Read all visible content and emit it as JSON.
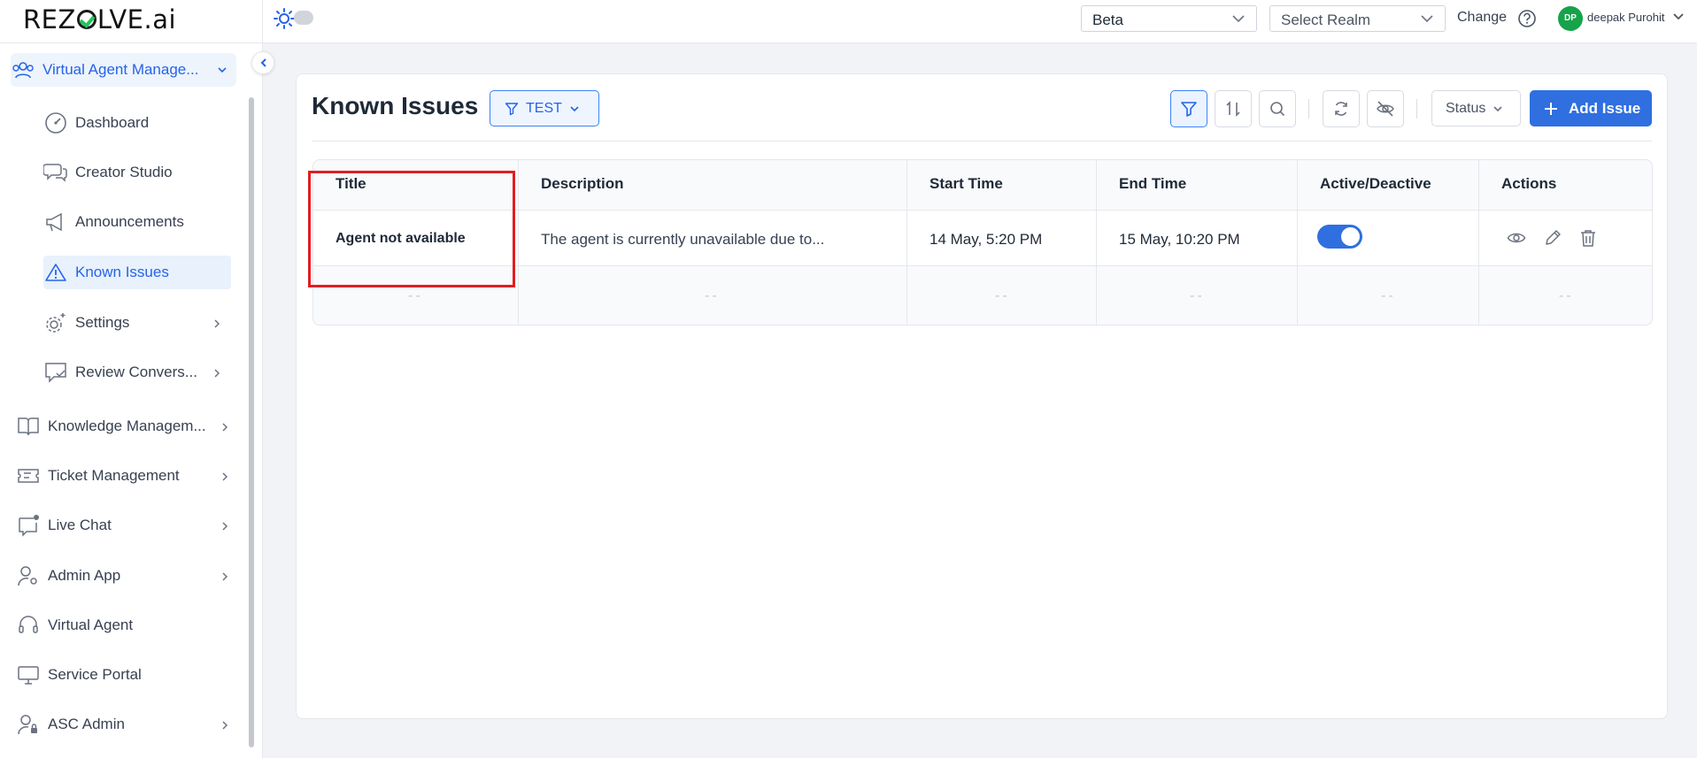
{
  "brand": {
    "logo_pre": "REZ",
    "logo_post": "LVE.ai"
  },
  "header": {
    "environment_select": "Beta",
    "realm_placeholder": "Select Realm",
    "change_label": "Change",
    "user_initials": "DP",
    "user_name": "deepak Purohit"
  },
  "sidebar": {
    "group": {
      "label": "Virtual Agent Manage..."
    },
    "sub_items": [
      {
        "label": "Dashboard",
        "icon": "gauge-icon"
      },
      {
        "label": "Creator Studio",
        "icon": "chat-bubbles-icon"
      },
      {
        "label": "Announcements",
        "icon": "megaphone-icon"
      },
      {
        "label": "Known Issues",
        "icon": "warning-icon",
        "active": true
      },
      {
        "label": "Settings",
        "icon": "gear-icon"
      },
      {
        "label": "Review Convers...",
        "icon": "chat-check-icon"
      }
    ],
    "items": [
      {
        "label": "Knowledge Managem...",
        "icon": "book-icon"
      },
      {
        "label": "Ticket Management",
        "icon": "ticket-icon"
      },
      {
        "label": "Live Chat",
        "icon": "live-chat-icon"
      },
      {
        "label": "Admin App",
        "icon": "user-gear-icon"
      },
      {
        "label": "Virtual Agent",
        "icon": "headset-icon"
      },
      {
        "label": "Service Portal",
        "icon": "monitor-icon"
      },
      {
        "label": "ASC Admin",
        "icon": "user-lock-icon"
      }
    ]
  },
  "page": {
    "title": "Known Issues",
    "filter_chip": "TEST",
    "status_button": "Status",
    "add_button": "Add Issue"
  },
  "table": {
    "columns": [
      "Title",
      "Description",
      "Start Time",
      "End Time",
      "Active/Deactive",
      "Actions"
    ],
    "rows": [
      {
        "title": "Agent not available",
        "description": "The agent is currently unavailable due to...",
        "start_time": "14 May, 5:20 PM",
        "end_time": "15 May, 10:20 PM",
        "active": true
      }
    ],
    "empty_placeholder": "--"
  },
  "colors": {
    "accent": "#2f6fe0",
    "highlight": "#e11d22",
    "avatar": "#16a34a"
  }
}
